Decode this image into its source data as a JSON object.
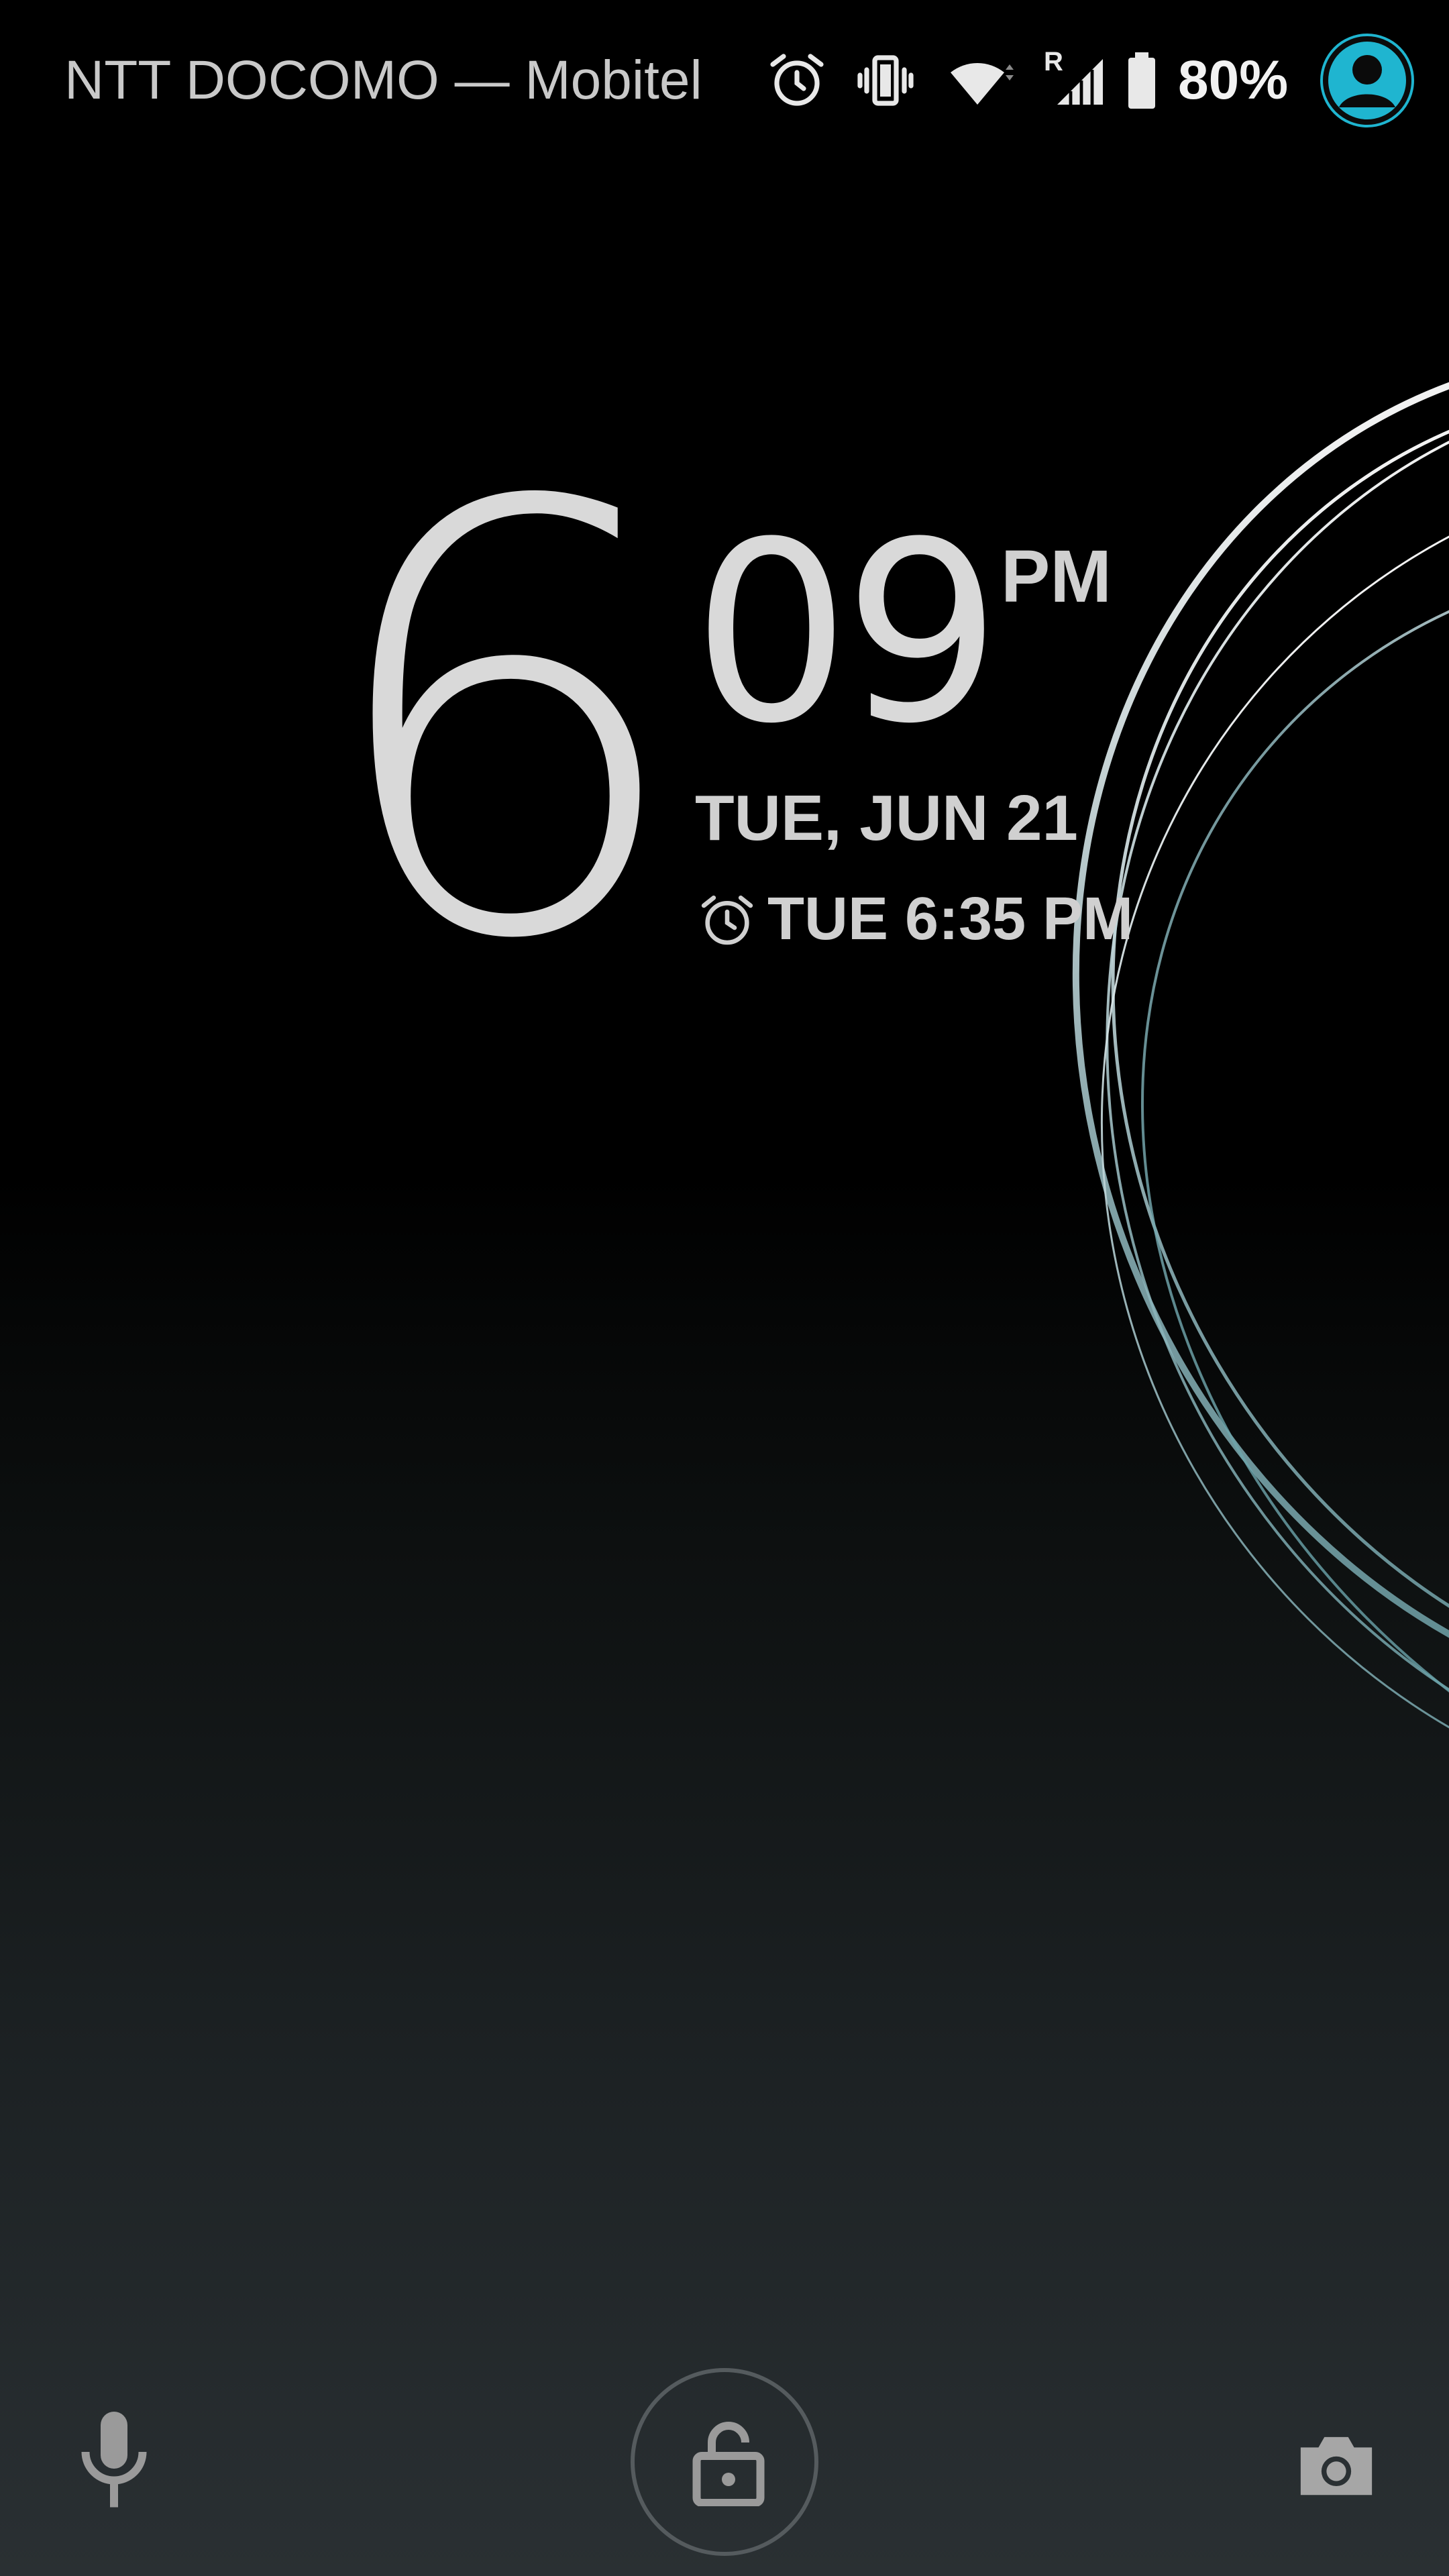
{
  "status_bar": {
    "carrier": "NTT DOCOMO — Mobitel",
    "roaming_indicator": "R",
    "battery_percent": "80%",
    "icons": [
      "alarm-icon",
      "vibrate-icon",
      "wifi-icon",
      "signal-icon",
      "battery-icon",
      "user-avatar-icon"
    ],
    "avatar_color": "#1fb5d0"
  },
  "clock": {
    "hour": "6",
    "minute": "09",
    "ampm": "PM",
    "date": "TUE, JUN 21",
    "next_alarm": "TUE 6:35 PM"
  },
  "bottom_bar": {
    "icons": [
      "microphone-icon",
      "lock-icon",
      "camera-icon"
    ]
  }
}
